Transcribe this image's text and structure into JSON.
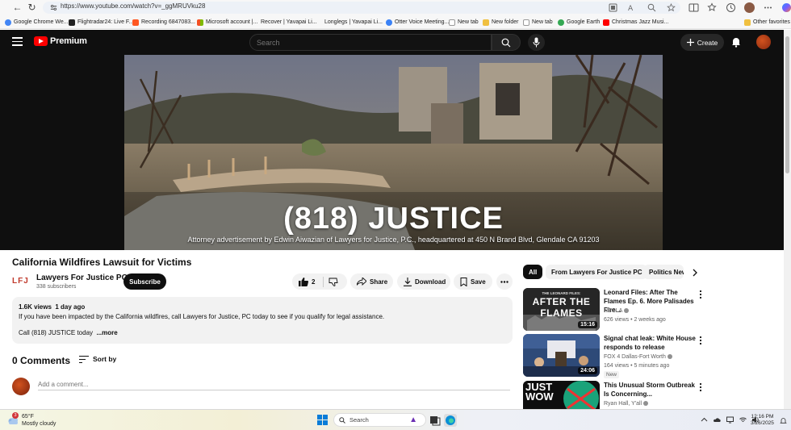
{
  "browser": {
    "url": "https://www.youtube.com/watch?v=_ggMRUVku28",
    "bookmarks": [
      {
        "label": "Google Chrome We...",
        "color": "#4285f4"
      },
      {
        "label": "Flightradar24: Live F...",
        "color": "#222222"
      },
      {
        "label": "Recording 6847083...",
        "color": "#ff5722"
      },
      {
        "label": "Microsoft account |...",
        "color": "#00a4ef"
      },
      {
        "label": "Recover | Yavapai Li...",
        "color": "#888888"
      },
      {
        "label": "Longlegs | Yavapai Li...",
        "color": "#888888"
      },
      {
        "label": "Otter Voice Meeting...",
        "color": "#3b82f6"
      },
      {
        "label": "New tab",
        "color": "#999999"
      },
      {
        "label": "New folder",
        "color": "#f0c040"
      },
      {
        "label": "New tab",
        "color": "#999999"
      },
      {
        "label": "Google Earth",
        "color": "#34a853"
      },
      {
        "label": "Christmas Jazz Musi...",
        "color": "#ff0000"
      }
    ],
    "other_favorites": "Other favorites"
  },
  "youtube": {
    "logo_text": "Premium",
    "search_placeholder": "Search",
    "create_label": "Create",
    "video": {
      "overlay_title": "(818) JUSTICE",
      "overlay_subtitle": "Attorney advertisement by Edwin Aiwazian of Lawyers for Justice, P.C., headquartered at 450 N Brand Blvd, Glendale CA 91203",
      "title": "California Wildfires Lawsuit for Victims",
      "channel_logo": "LFJ",
      "channel_name": "Lawyers For Justice PC",
      "subscribers": "338 subscribers",
      "subscribe_label": "Subscribe",
      "like_count": "2",
      "share_label": "Share",
      "download_label": "Download",
      "save_label": "Save",
      "views": "1.6K views",
      "age": "1 day ago",
      "description_line1": "If you have been impacted by the California wildfires, call Lawyers for Justice, PC today to see if you qualify for legal assistance.",
      "description_line2": "Call (818) JUSTICE today",
      "more_label": "...more",
      "comments_count": "0 Comments",
      "sort_label": "Sort by",
      "comment_placeholder": "Add a comment..."
    },
    "chips": [
      "All",
      "From Lawyers For Justice PC",
      "Politics News"
    ],
    "recommendations": [
      {
        "title": "Leonard Files: After The Flames Ep. 6. More Palisades Fire...",
        "channel": "NBCLA",
        "meta": "626 views • 2 weeks ago",
        "duration": "15:16",
        "thumb_text": "AFTER THE FLAMES",
        "thumb_kicker": "THE LEONARD FILES:"
      },
      {
        "title": "Signal chat leak: White House responds to release",
        "channel": "FOX 4 Dallas-Fort Worth",
        "meta": "164 views • 5 minutes ago",
        "duration": "24:06",
        "badge": "New"
      },
      {
        "title": "This Unusual Storm Outbreak Is Concerning...",
        "channel": "Ryan Hall, Y'all",
        "thumb_text": "JUST WOW"
      }
    ]
  },
  "taskbar": {
    "weather_temp": "65°F",
    "weather_desc": "Mostly cloudy",
    "weather_alert": "3",
    "search_label": "Search",
    "time": "12:16 PM",
    "date": "3/26/2025"
  }
}
